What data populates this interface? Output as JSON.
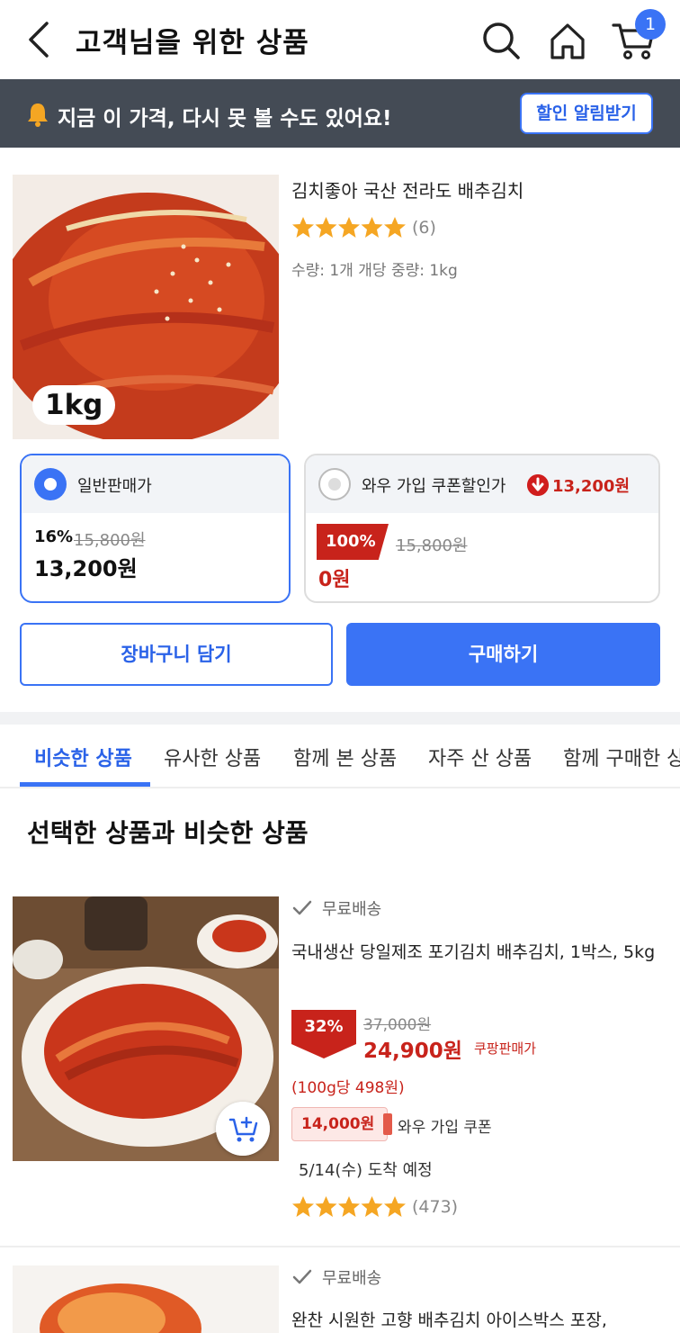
{
  "header": {
    "title": "고객님을 위한 상품",
    "cart_count": "1"
  },
  "notice": {
    "text": "지금 이 가격, 다시 못 볼 수도 있어요!",
    "button": "할인 알림받기"
  },
  "product": {
    "image_badge": "1kg",
    "name": "김치좋아 국산 전라도 배추김치",
    "rating": 5,
    "review_count": "(6)",
    "info": "수량: 1개 개당 중량: 1kg"
  },
  "options": [
    {
      "title": "일반판매가",
      "selected": true,
      "discount": "16%",
      "original_price": "15,800원",
      "price": "13,200원"
    },
    {
      "title": "와우 가입 쿠폰할인가",
      "selected": false,
      "drop_price": "13,200원",
      "discount": "100%",
      "original_price": "15,800원",
      "price": "0원"
    }
  ],
  "actions": {
    "cart": "장바구니 담기",
    "buy": "구매하기"
  },
  "tabs": [
    "비슷한 상품",
    "유사한 상품",
    "함께 본 상품",
    "자주 산 상품",
    "함께 구매한 상품"
  ],
  "section_title": "선택한 상품과 비슷한 상품",
  "listings": [
    {
      "shipping": "무료배송",
      "name": "국내생산 당일제조 포기김치 배추김치, 1박스, 5kg",
      "discount": "32%",
      "original_price": "37,000원",
      "price": "24,900원",
      "seller": "쿠팡판매가",
      "unit_price": "(100g당 498원)",
      "coupon_price": "14,000원",
      "coupon_label": "와우 가입 쿠폰",
      "delivery": "5/14(수) 도착 예정",
      "rating": 5,
      "review_count": "(473)"
    },
    {
      "shipping": "무료배송",
      "name": "완찬 시원한 고향 배추김치 아이스박스 포장,"
    }
  ],
  "colors": {
    "accent": "#3a73f5",
    "sale": "#c8231b",
    "notice_bg": "#444b55",
    "star": "#f5a623"
  },
  "icons": [
    "back-arrow-icon",
    "search-icon",
    "home-icon",
    "cart-icon",
    "bell-icon",
    "star-icon",
    "arrow-down-circle-icon",
    "check-icon",
    "add-to-cart-icon"
  ]
}
